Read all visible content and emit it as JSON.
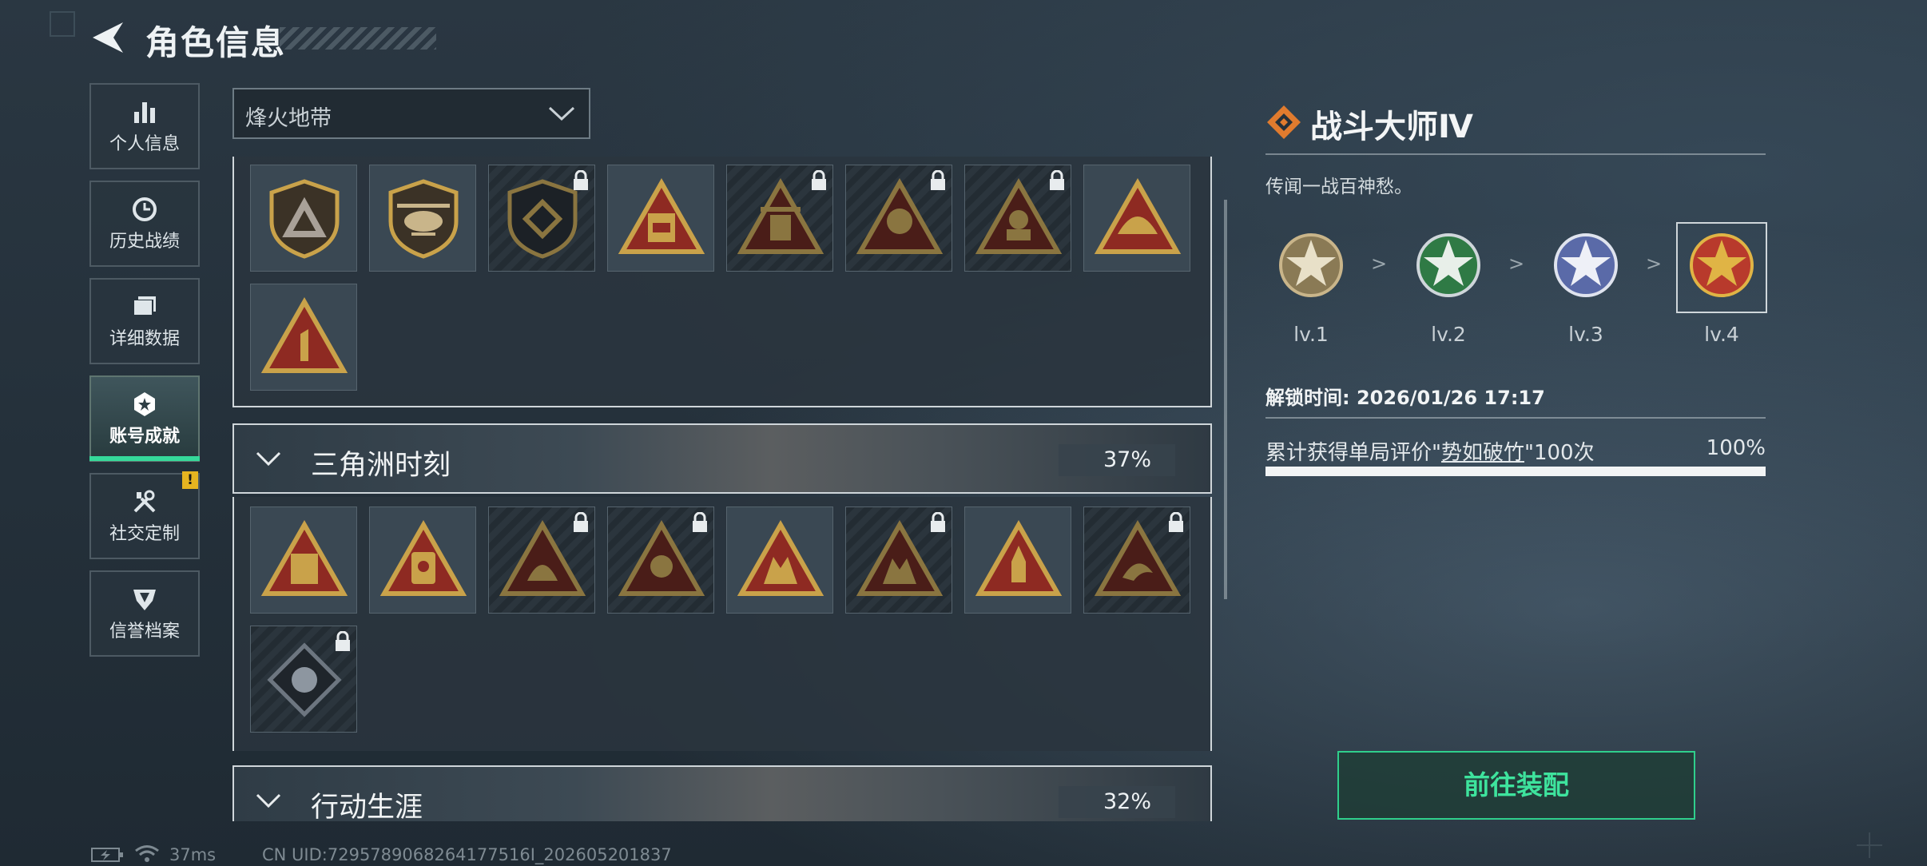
{
  "header": {
    "title": "角色信息"
  },
  "sidebar": {
    "items": [
      {
        "label": "个人信息",
        "icon": "bar-chart-icon"
      },
      {
        "label": "历史战绩",
        "icon": "history-clock-icon"
      },
      {
        "label": "详细数据",
        "icon": "cards-icon"
      },
      {
        "label": "账号成就",
        "icon": "achievement-star-icon",
        "active": true
      },
      {
        "label": "社交定制",
        "icon": "tools-icon",
        "badge": "!"
      },
      {
        "label": "信誉档案",
        "icon": "shield-wing-icon"
      }
    ]
  },
  "filter": {
    "selected": "烽火地带"
  },
  "categories": [
    {
      "name": "三角洲时刻",
      "percent": "37%"
    },
    {
      "name": "行动生涯",
      "percent": "32%"
    }
  ],
  "detail": {
    "title": "战斗大师Ⅳ",
    "description": "传闻一战百神愁。",
    "levels": [
      {
        "label": "lv.1",
        "color": "#8a7a55"
      },
      {
        "label": "lv.2",
        "color": "#2f7a45"
      },
      {
        "label": "lv.3",
        "color": "#5a6aa8"
      },
      {
        "label": "lv.4",
        "color": "#b83a2c"
      }
    ],
    "separator": ">",
    "unlock_text": "解锁时间: 2026/01/26 17:17",
    "requirement_prefix": "累计获得单局评价\"",
    "requirement_highlight": "势如破竹",
    "requirement_suffix": "\"100次",
    "progress_label": "100%",
    "progress_value": 1.0
  },
  "equip_button": {
    "label": "前往装配"
  },
  "status_bar": {
    "ping": "37ms",
    "uid": "CN UID:7295789068264177516I_202605201837"
  },
  "colors": {
    "accent_green": "#35d99a",
    "gold": "#c9a24a",
    "badge_red": "#8e2a22",
    "warning": "#e6b420"
  }
}
